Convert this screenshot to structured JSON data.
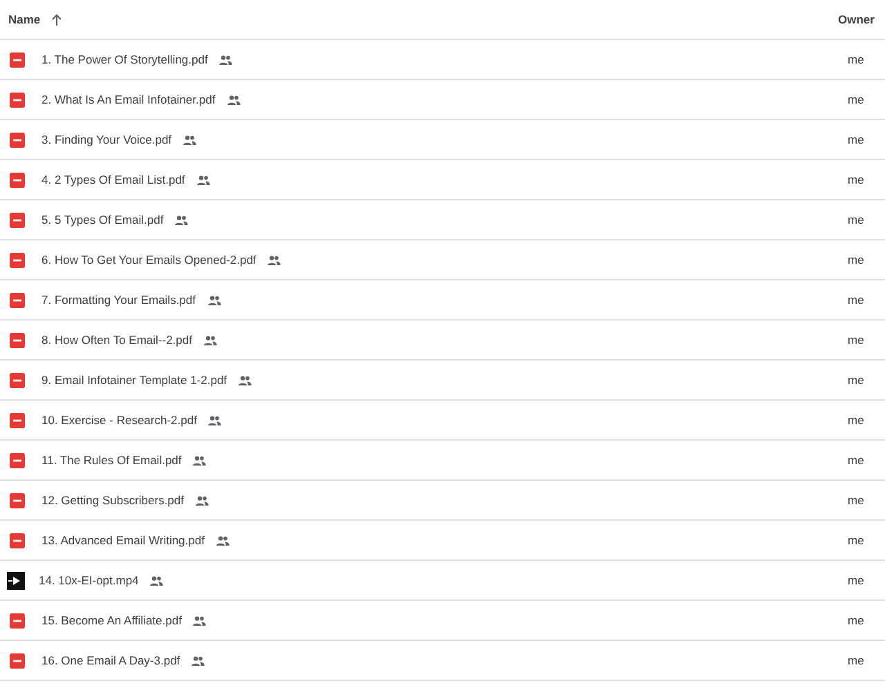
{
  "columns": [
    {
      "label": "Name",
      "sorted": true
    },
    {
      "label": "Owner"
    }
  ],
  "files": [
    {
      "kind": "pdf",
      "name": "1. The Power Of Storytelling.pdf",
      "shared": true,
      "owner": "me"
    },
    {
      "kind": "pdf",
      "name": "2. What Is An Email Infotainer.pdf",
      "shared": true,
      "owner": "me"
    },
    {
      "kind": "pdf",
      "name": "3. Finding Your Voice.pdf",
      "shared": true,
      "owner": "me"
    },
    {
      "kind": "pdf",
      "name": "4. 2 Types Of Email List.pdf",
      "shared": true,
      "owner": "me"
    },
    {
      "kind": "pdf",
      "name": "5. 5 Types Of Email.pdf",
      "shared": true,
      "owner": "me"
    },
    {
      "kind": "pdf",
      "name": "6. How To Get Your Emails Opened-2.pdf",
      "shared": true,
      "owner": "me"
    },
    {
      "kind": "pdf",
      "name": "7. Formatting Your Emails.pdf",
      "shared": true,
      "owner": "me"
    },
    {
      "kind": "pdf",
      "name": "8. How Often To Email--2.pdf",
      "shared": true,
      "owner": "me"
    },
    {
      "kind": "pdf",
      "name": "9. Email Infotainer Template 1-2.pdf",
      "shared": true,
      "owner": "me"
    },
    {
      "kind": "pdf",
      "name": "10. Exercise - Research-2.pdf",
      "shared": true,
      "owner": "me"
    },
    {
      "kind": "pdf",
      "name": "11. The Rules Of Email.pdf",
      "shared": true,
      "owner": "me"
    },
    {
      "kind": "pdf",
      "name": "12. Getting Subscribers.pdf",
      "shared": true,
      "owner": "me"
    },
    {
      "kind": "pdf",
      "name": "13. Advanced Email Writing.pdf",
      "shared": true,
      "owner": "me"
    },
    {
      "kind": "video",
      "name": "14. 10x-EI-opt.mp4",
      "shared": true,
      "owner": "me"
    },
    {
      "kind": "pdf",
      "name": "15. Become An Affiliate.pdf",
      "shared": true,
      "owner": "me"
    },
    {
      "kind": "pdf",
      "name": "16. One Email A Day-3.pdf",
      "shared": true,
      "owner": "me"
    }
  ]
}
